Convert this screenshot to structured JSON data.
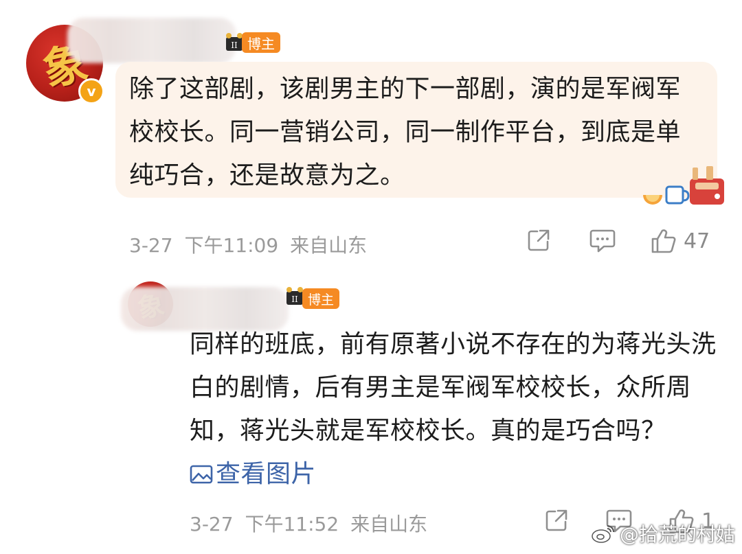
{
  "comment1": {
    "author_tag": "博主",
    "avatar_icon": "red-avatar-icon",
    "verified_badge": "v",
    "text": "除了这部剧，该剧男主的下一部剧，演的是军阀军校校长。同一营销公司，同一制作平台，到底是单纯巧合，还是故意为之。",
    "meta": {
      "date": "3-27",
      "time": "下午11:09",
      "location": "来自山东"
    },
    "actions": {
      "share_icon": "share-icon",
      "comment_icon": "comment-icon",
      "like_icon": "thumbs-up-icon",
      "like_count": "47"
    }
  },
  "comment2": {
    "author_tag": "博主",
    "avatar_icon": "red-avatar-icon",
    "text": "同样的班底，前有原著小说不存在的为蒋光头洗白的剧情，后有男主是军阀军校校长，众所周知，蒋光头就是军校校长。真的是巧合吗？",
    "view_image_label": "查看图片",
    "meta": {
      "date": "3-27",
      "time": "下午11:52",
      "location": "来自山东"
    },
    "actions": {
      "share_icon": "share-icon",
      "comment_icon": "comment-icon",
      "like_icon": "thumbs-up-icon",
      "like_count": "1"
    }
  },
  "watermark": {
    "text": "@拾荒的村姑",
    "icon": "weibo-logo-icon"
  },
  "colors": {
    "tag_orange": "#f58a23",
    "bubble_bg": "#fdf3ea",
    "link_blue": "#3d64a8",
    "meta_gray": "#9a9a9a"
  }
}
